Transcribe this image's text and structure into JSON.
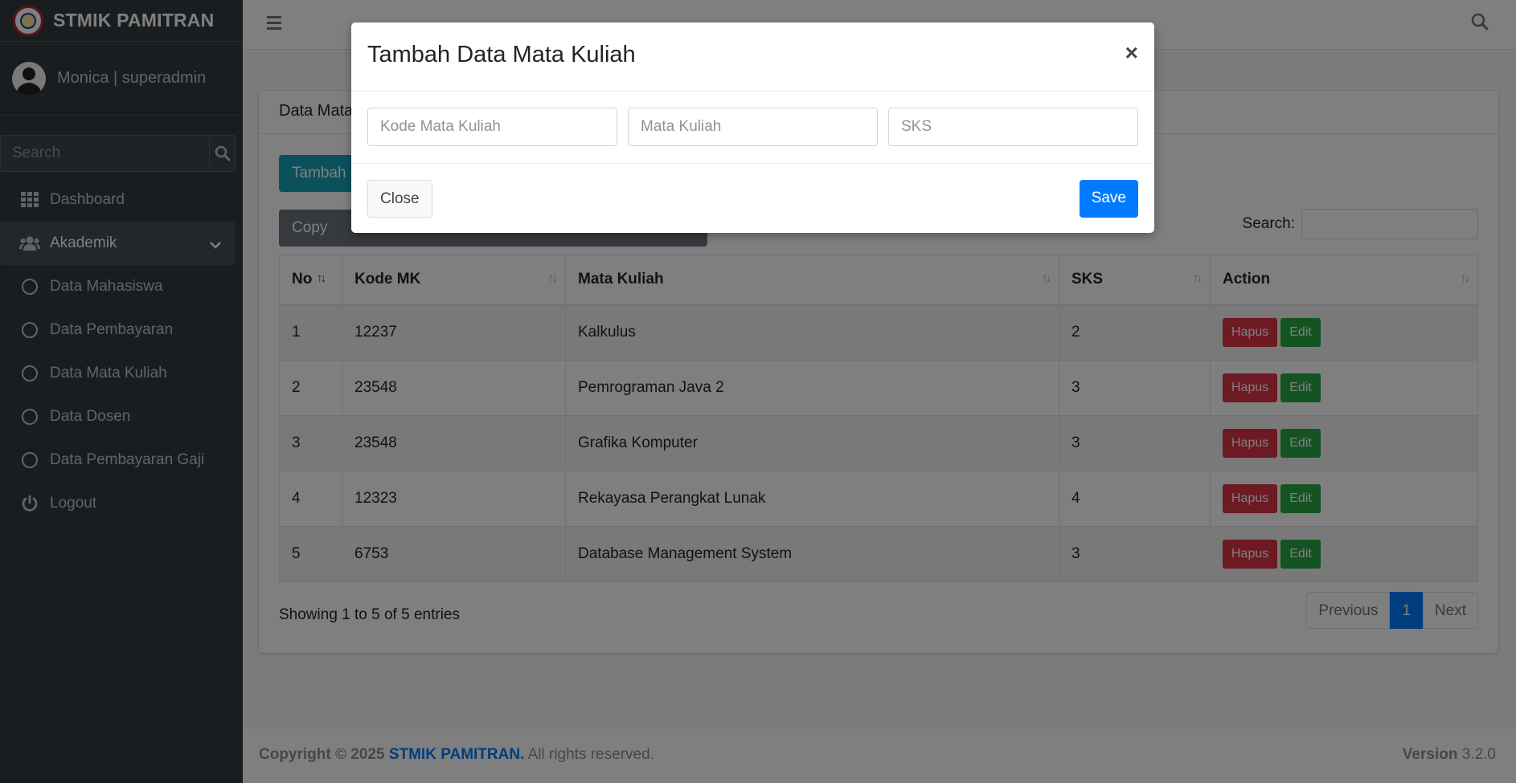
{
  "brand": {
    "name": "STMIK PAMITRAN"
  },
  "user": {
    "name": "Monica | superadmin"
  },
  "sidebar": {
    "search_placeholder": "Search",
    "items": [
      {
        "label": "Dashboard",
        "icon": "grid-icon"
      },
      {
        "label": "Akademik",
        "icon": "users-icon",
        "active": true
      },
      {
        "label": "Data Mahasiswa",
        "icon": "circle-icon"
      },
      {
        "label": "Data Pembayaran",
        "icon": "circle-icon"
      },
      {
        "label": "Data Mata Kuliah",
        "icon": "circle-icon"
      },
      {
        "label": "Data Dosen",
        "icon": "circle-icon"
      },
      {
        "label": "Data Pembayaran Gaji",
        "icon": "circle-icon"
      },
      {
        "label": "Logout",
        "icon": "power-icon"
      }
    ]
  },
  "card": {
    "title": "Data Mata",
    "add_button": "Tambah",
    "copy_button": "Copy",
    "search_label": "Search:",
    "table": {
      "headers": [
        "No",
        "Kode MK",
        "Mata Kuliah",
        "SKS",
        "Action"
      ],
      "rows": [
        {
          "no": "1",
          "kode": "12237",
          "mk": "Kalkulus",
          "sks": "2"
        },
        {
          "no": "2",
          "kode": "23548",
          "mk": "Pemrograman Java 2",
          "sks": "3"
        },
        {
          "no": "3",
          "kode": "23548",
          "mk": "Grafika Komputer",
          "sks": "3"
        },
        {
          "no": "4",
          "kode": "12323",
          "mk": "Rekayasa Perangkat Lunak",
          "sks": "4"
        },
        {
          "no": "5",
          "kode": "6753",
          "mk": "Database Management System",
          "sks": "3"
        }
      ],
      "delete_label": "Hapus",
      "edit_label": "Edit"
    },
    "info": "Showing 1 to 5 of 5 entries",
    "pagination": {
      "previous": "Previous",
      "current": "1",
      "next": "Next"
    }
  },
  "footer": {
    "copyright": "Copyright © 2025",
    "brand": "STMIK PAMITRAN.",
    "rights": "All rights reserved.",
    "version_label": "Version",
    "version": "3.2.0"
  },
  "modal": {
    "title": "Tambah Data Mata Kuliah",
    "close_symbol": "×",
    "kode_placeholder": "Kode Mata Kuliah",
    "mk_placeholder": "Mata Kuliah",
    "sks_placeholder": "SKS",
    "close_button": "Close",
    "save_button": "Save"
  },
  "colors": {
    "sidebar": "#343a40",
    "primary": "#007bff",
    "info": "#17a2b8",
    "danger": "#dc3545",
    "success": "#28a745"
  }
}
